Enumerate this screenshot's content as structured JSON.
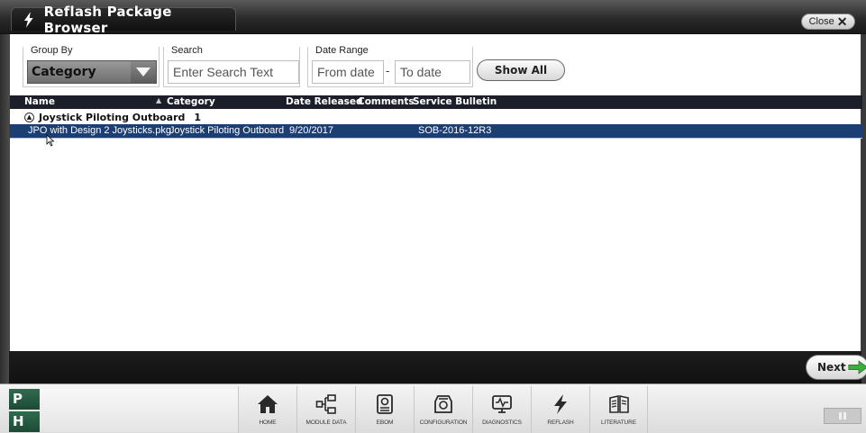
{
  "window": {
    "title": "Reflash Package Browser",
    "close_label": "Close"
  },
  "filters": {
    "group_by_label": "Group By",
    "group_by_value": "Category",
    "search_label": "Search",
    "search_placeholder": "Enter Search Text",
    "date_range_label": "Date Range",
    "date_from_placeholder": "From date",
    "date_separator": "-",
    "date_to_placeholder": "To date",
    "show_all_label": "Show All"
  },
  "table": {
    "columns": {
      "name": "Name",
      "category": "Category",
      "date_released": "Date Released",
      "comments": "Comments",
      "service_bulletin": "Service Bulletin"
    },
    "group": {
      "label": "Joystick Piloting Outboard",
      "count": "1"
    },
    "rows": [
      {
        "name": "JPO with Design 2 Joysticks.pkg",
        "category": "Joystick Piloting Outboard",
        "date_released": "9/20/2017",
        "comments": "",
        "service_bulletin": "SOB-2016-12R3"
      }
    ]
  },
  "actions": {
    "next_label": "Next"
  },
  "logo": {
    "top": "P",
    "bottom": "H"
  },
  "nav": {
    "items": [
      {
        "label": "HOME",
        "icon": "home-icon"
      },
      {
        "label": "MODULE DATA",
        "icon": "module-data-icon"
      },
      {
        "label": "EBOM",
        "icon": "ebom-icon"
      },
      {
        "label": "CONFIGURATION",
        "icon": "configuration-icon"
      },
      {
        "label": "DIAGNOSTICS",
        "icon": "diagnostics-icon"
      },
      {
        "label": "REFLASH",
        "icon": "reflash-icon"
      },
      {
        "label": "LITERATURE",
        "icon": "literature-icon"
      }
    ]
  },
  "colors": {
    "selected_row": "#1b3e74",
    "header_bg": "#1c1f2a",
    "logo_green": "#2f6b4f",
    "next_arrow": "#3dae3d"
  }
}
